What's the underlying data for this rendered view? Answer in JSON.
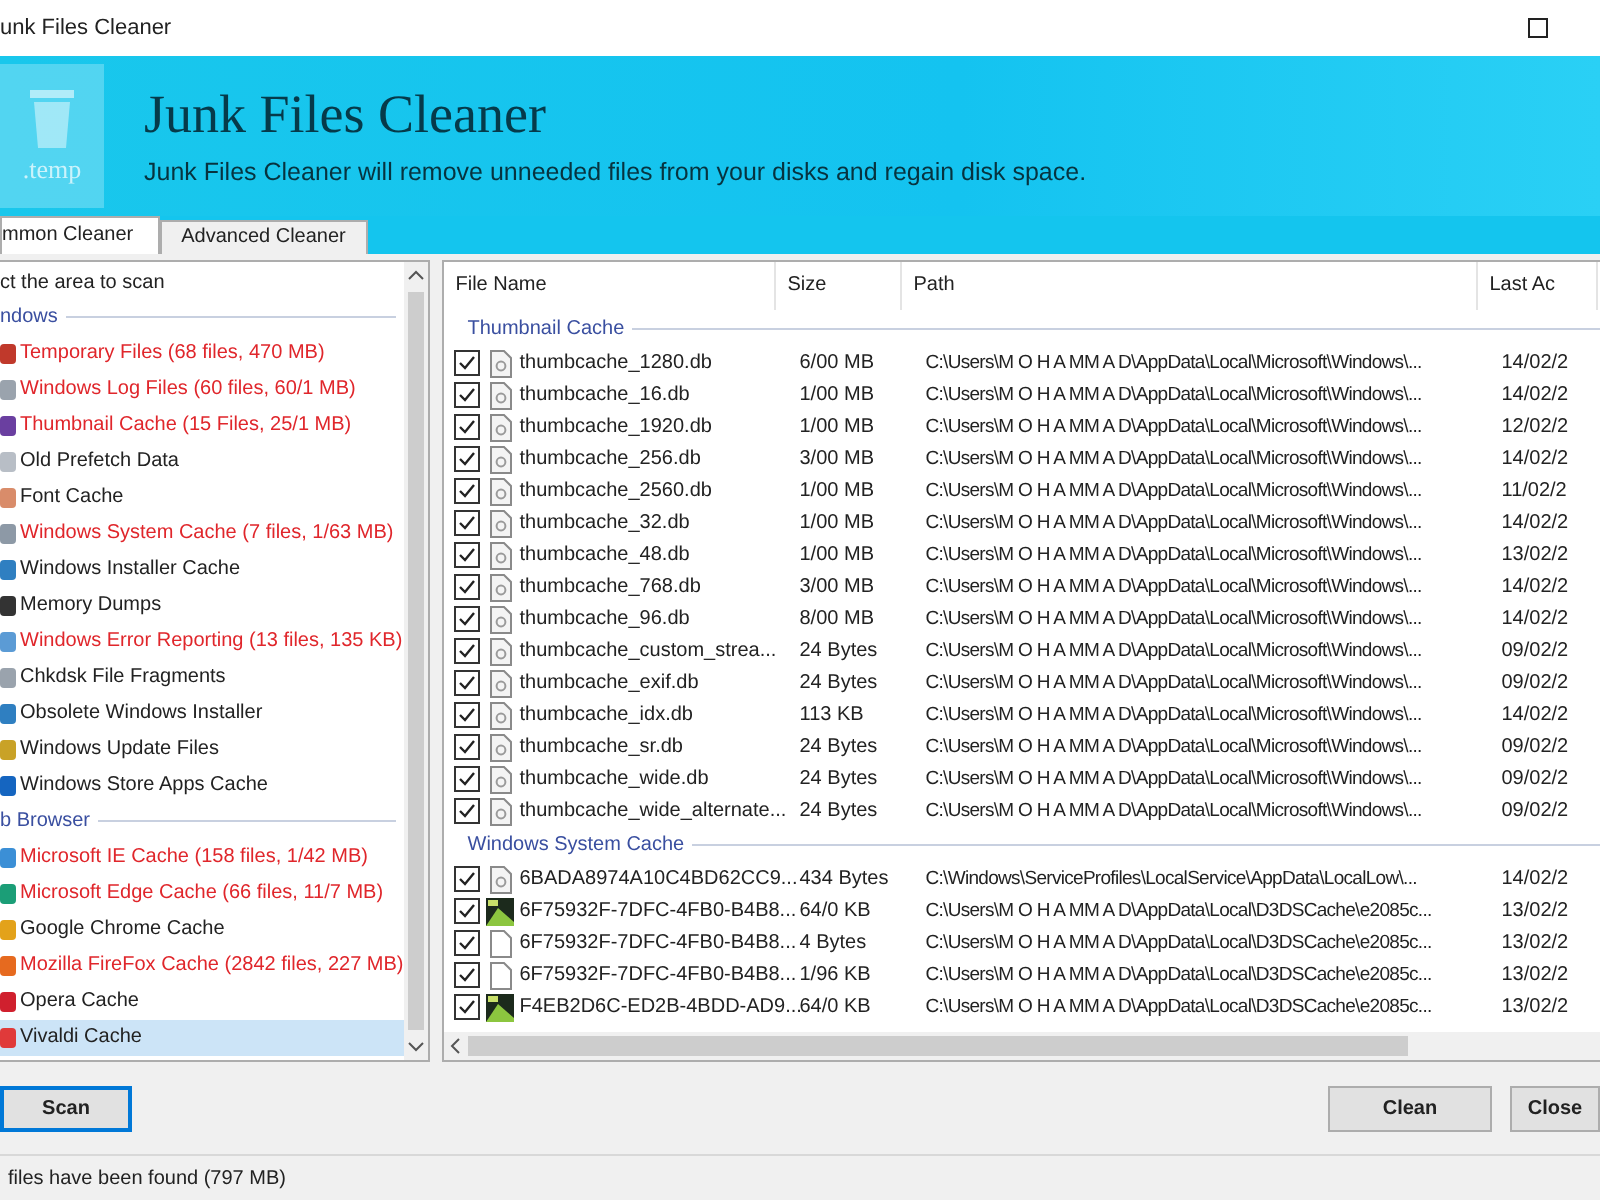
{
  "window": {
    "title": "unk Files Cleaner"
  },
  "banner": {
    "logo_text": ".temp",
    "heading": "Junk Files Cleaner",
    "subtitle": "Junk Files Cleaner will remove unneeded files from your disks and regain disk space."
  },
  "tabs": [
    {
      "label": "mmon Cleaner",
      "selected": true
    },
    {
      "label": "Advanced Cleaner",
      "selected": false
    }
  ],
  "scan_area": {
    "title": "ct the area to scan",
    "groups": [
      {
        "name": "ndows",
        "items": [
          {
            "label": "Temporary Files (68 files, 470 MB)",
            "found": true,
            "selected": false,
            "color": "#c0392b"
          },
          {
            "label": "Windows Log Files (60 files, 60/1 MB)",
            "found": true,
            "selected": false,
            "color": "#9aa3ad"
          },
          {
            "label": "Thumbnail Cache (15 Files, 25/1 MB)",
            "found": true,
            "selected": false,
            "color": "#6a3fa0"
          },
          {
            "label": "Old Prefetch Data",
            "found": false,
            "selected": false,
            "color": "#b8bec6"
          },
          {
            "label": "Font Cache",
            "found": false,
            "selected": false,
            "color": "#d98c6a"
          },
          {
            "label": "Windows System Cache (7 files, 1/63 MB)",
            "found": true,
            "selected": false,
            "color": "#8d99a6"
          },
          {
            "label": "Windows Installer Cache",
            "found": false,
            "selected": false,
            "color": "#2f7fc1"
          },
          {
            "label": "Memory Dumps",
            "found": false,
            "selected": false,
            "color": "#333333"
          },
          {
            "label": "Windows Error Reporting (13 files, 135 KB)",
            "found": true,
            "selected": false,
            "color": "#5b9bd5"
          },
          {
            "label": "Chkdsk File Fragments",
            "found": false,
            "selected": false,
            "color": "#9aa3ad"
          },
          {
            "label": "Obsolete Windows Installer",
            "found": false,
            "selected": false,
            "color": "#2f7fc1"
          },
          {
            "label": "Windows Update Files",
            "found": false,
            "selected": false,
            "color": "#c9a227"
          },
          {
            "label": "Windows Store Apps Cache",
            "found": false,
            "selected": false,
            "color": "#1565c0"
          }
        ]
      },
      {
        "name": "b Browser",
        "items": [
          {
            "label": "Microsoft IE Cache (158 files, 1/42 MB)",
            "found": true,
            "selected": false,
            "color": "#3b8fd6"
          },
          {
            "label": "Microsoft Edge Cache (66 files, 11/7 MB)",
            "found": true,
            "selected": false,
            "color": "#1b9e77"
          },
          {
            "label": "Google Chrome Cache",
            "found": false,
            "selected": false,
            "color": "#e3a21a"
          },
          {
            "label": "Mozilla FireFox Cache (2842 files, 227 MB)",
            "found": true,
            "selected": false,
            "color": "#e66a1f"
          },
          {
            "label": "Opera Cache",
            "found": false,
            "selected": false,
            "color": "#d0202e"
          },
          {
            "label": "Vivaldi Cache",
            "found": false,
            "selected": true,
            "color": "#e03a3a"
          }
        ]
      }
    ]
  },
  "table": {
    "columns": [
      "File Name",
      "Size",
      "Path",
      "Last Ac"
    ],
    "groups": [
      {
        "name": "Thumbnail Cache",
        "rows": [
          {
            "kind": "doc",
            "checked": true,
            "cells": [
              "thumbcache_1280.db",
              "6/00 MB",
              "C:\\Users\\M O H A MM A D\\AppData\\Local\\Microsoft\\Windows\\...",
              "14/02/2"
            ]
          },
          {
            "kind": "doc",
            "checked": true,
            "cells": [
              "thumbcache_16.db",
              "1/00 MB",
              "C:\\Users\\M O H A MM A D\\AppData\\Local\\Microsoft\\Windows\\...",
              "14/02/2"
            ]
          },
          {
            "kind": "doc",
            "checked": true,
            "cells": [
              "thumbcache_1920.db",
              "1/00 MB",
              "C:\\Users\\M O H A MM A D\\AppData\\Local\\Microsoft\\Windows\\...",
              "12/02/2"
            ]
          },
          {
            "kind": "doc",
            "checked": true,
            "cells": [
              "thumbcache_256.db",
              "3/00 MB",
              "C:\\Users\\M O H A MM A D\\AppData\\Local\\Microsoft\\Windows\\...",
              "14/02/2"
            ]
          },
          {
            "kind": "doc",
            "checked": true,
            "cells": [
              "thumbcache_2560.db",
              "1/00 MB",
              "C:\\Users\\M O H A MM A D\\AppData\\Local\\Microsoft\\Windows\\...",
              "11/02/2"
            ]
          },
          {
            "kind": "doc",
            "checked": true,
            "cells": [
              "thumbcache_32.db",
              "1/00 MB",
              "C:\\Users\\M O H A MM A D\\AppData\\Local\\Microsoft\\Windows\\...",
              "14/02/2"
            ]
          },
          {
            "kind": "doc",
            "checked": true,
            "cells": [
              "thumbcache_48.db",
              "1/00 MB",
              "C:\\Users\\M O H A MM A D\\AppData\\Local\\Microsoft\\Windows\\...",
              "13/02/2"
            ]
          },
          {
            "kind": "doc",
            "checked": true,
            "cells": [
              "thumbcache_768.db",
              "3/00 MB",
              "C:\\Users\\M O H A MM A D\\AppData\\Local\\Microsoft\\Windows\\...",
              "14/02/2"
            ]
          },
          {
            "kind": "doc",
            "checked": true,
            "cells": [
              "thumbcache_96.db",
              "8/00 MB",
              "C:\\Users\\M O H A MM A D\\AppData\\Local\\Microsoft\\Windows\\...",
              "14/02/2"
            ]
          },
          {
            "kind": "doc",
            "checked": true,
            "cells": [
              "thumbcache_custom_strea...",
              "24 Bytes",
              "C:\\Users\\M O H A MM A D\\AppData\\Local\\Microsoft\\Windows\\...",
              "09/02/2"
            ]
          },
          {
            "kind": "doc",
            "checked": true,
            "cells": [
              "thumbcache_exif.db",
              "24 Bytes",
              "C:\\Users\\M O H A MM A D\\AppData\\Local\\Microsoft\\Windows\\...",
              "09/02/2"
            ]
          },
          {
            "kind": "doc",
            "checked": true,
            "cells": [
              "thumbcache_idx.db",
              "113 KB",
              "C:\\Users\\M O H A MM A D\\AppData\\Local\\Microsoft\\Windows\\...",
              "14/02/2"
            ]
          },
          {
            "kind": "doc",
            "checked": true,
            "cells": [
              "thumbcache_sr.db",
              "24 Bytes",
              "C:\\Users\\M O H A MM A D\\AppData\\Local\\Microsoft\\Windows\\...",
              "09/02/2"
            ]
          },
          {
            "kind": "doc",
            "checked": true,
            "cells": [
              "thumbcache_wide.db",
              "24 Bytes",
              "C:\\Users\\M O H A MM A D\\AppData\\Local\\Microsoft\\Windows\\...",
              "09/02/2"
            ]
          },
          {
            "kind": "doc",
            "checked": true,
            "cells": [
              "thumbcache_wide_alternate...",
              "24 Bytes",
              "C:\\Users\\M O H A MM A D\\AppData\\Local\\Microsoft\\Windows\\...",
              "09/02/2"
            ]
          }
        ]
      },
      {
        "name": "Windows System Cache",
        "rows": [
          {
            "kind": "doc",
            "checked": true,
            "cells": [
              "6BADA8974A10C4BD62CC9...",
              "434 Bytes",
              "C:\\Windows\\ServiceProfiles\\LocalService\\AppData\\LocalLow\\...",
              "14/02/2"
            ]
          },
          {
            "kind": "image",
            "checked": true,
            "cells": [
              "6F75932F-7DFC-4FB0-B4B8...",
              "64/0 KB",
              "C:\\Users\\M O H A MM A D\\AppData\\Local\\D3DSCache\\e2085c...",
              "13/02/2"
            ]
          },
          {
            "kind": "blank",
            "checked": true,
            "cells": [
              "6F75932F-7DFC-4FB0-B4B8...",
              "4 Bytes",
              "C:\\Users\\M O H A MM A D\\AppData\\Local\\D3DSCache\\e2085c...",
              "13/02/2"
            ]
          },
          {
            "kind": "blank",
            "checked": true,
            "cells": [
              "6F75932F-7DFC-4FB0-B4B8...",
              "1/96 KB",
              "C:\\Users\\M O H A MM A D\\AppData\\Local\\D3DSCache\\e2085c...",
              "13/02/2"
            ]
          },
          {
            "kind": "image",
            "checked": true,
            "cells": [
              "F4EB2D6C-ED2B-4BDD-AD9...",
              "64/0 KB",
              "C:\\Users\\M O H A MM A D\\AppData\\Local\\D3DSCache\\e2085c...",
              "13/02/2"
            ]
          }
        ]
      }
    ]
  },
  "buttons": {
    "scan": "Scan",
    "clean": "Clean",
    "close": "Close"
  },
  "status_bar": "files have been found (797 MB)"
}
